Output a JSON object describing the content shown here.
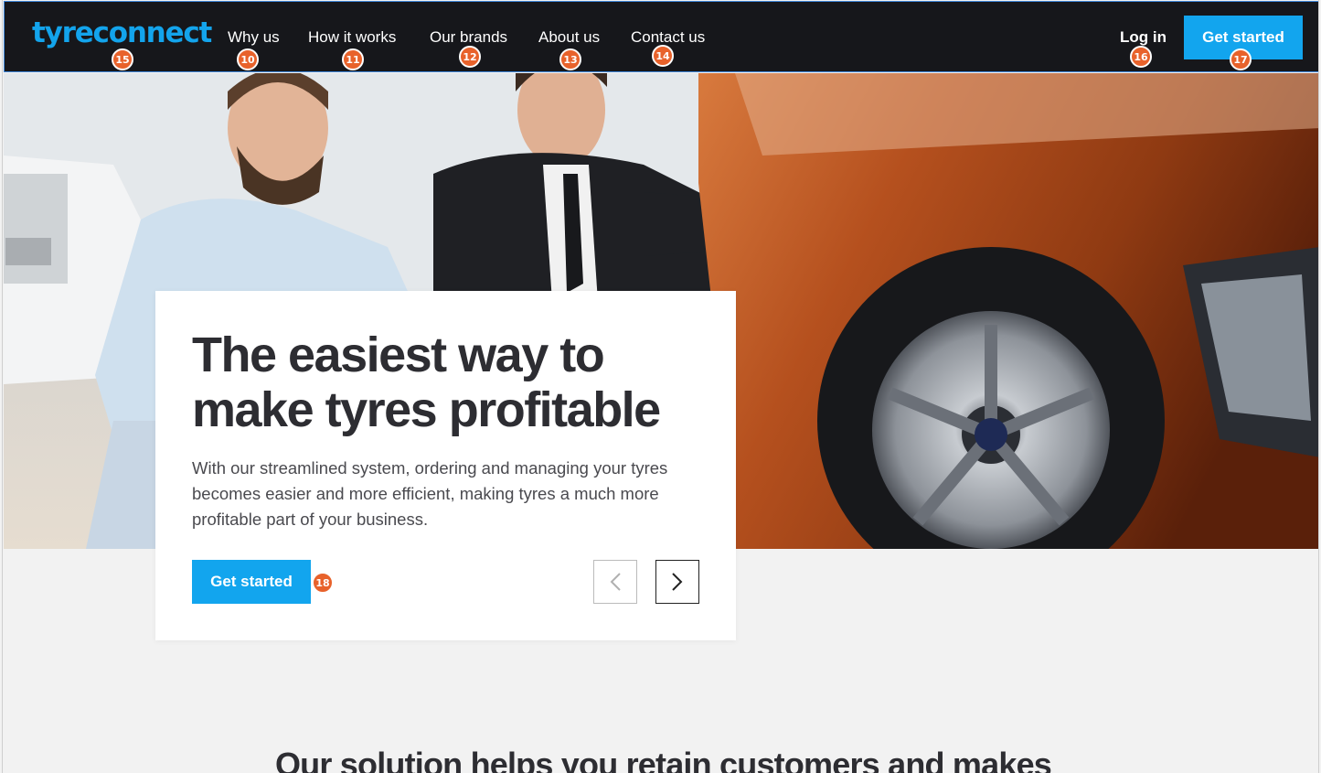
{
  "nav": {
    "logo": "tyreconnect",
    "links": [
      "Why us",
      "How it works",
      "Our brands",
      "About us",
      "Contact us"
    ],
    "login": "Log in",
    "cta": "Get started"
  },
  "hero": {
    "title_line1": "The easiest way to",
    "title_line2": "make tyres profitable",
    "description": "With our streamlined system, ordering and managing your tyres becomes easier and more efficient, making tyres a much more profitable part of your business.",
    "cta": "Get started"
  },
  "section": {
    "title": "Our solution helps you retain customers and makes"
  },
  "badges": {
    "logo": "15",
    "why_us": "10",
    "how_it_works": "11",
    "our_brands": "12",
    "about_us": "13",
    "contact_us": "14",
    "login": "16",
    "nav_cta": "17",
    "hero_cta": "18"
  },
  "colors": {
    "nav_bg": "#16171b",
    "accent": "#12a5ee",
    "badge": "#e8622b",
    "page_bg": "#f2f2f2"
  }
}
